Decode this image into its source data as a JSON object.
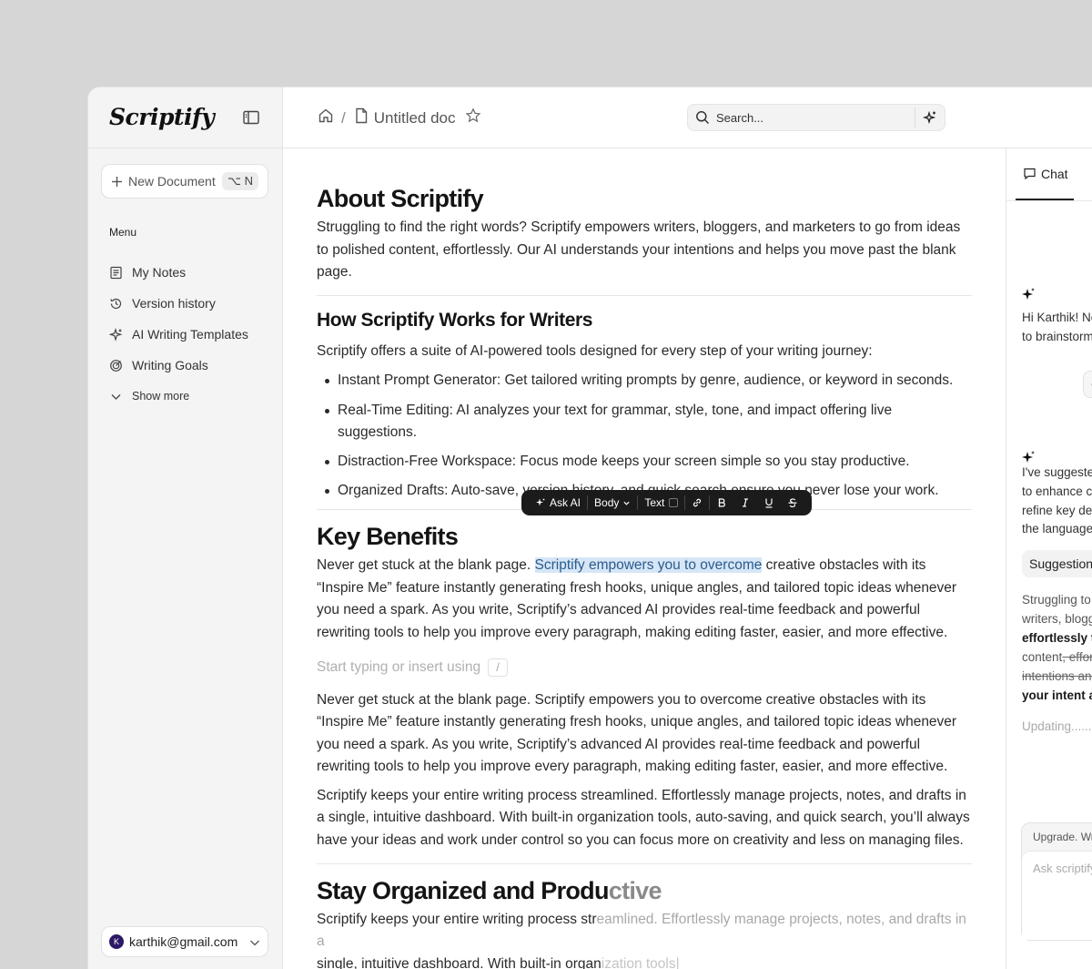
{
  "app": {
    "name": "Scriptify"
  },
  "sidebar": {
    "new_document_label": "New Document",
    "new_document_shortcut": "⌥ N",
    "menu_title": "Menu",
    "items": [
      {
        "label": "My Notes",
        "icon": "notes-icon"
      },
      {
        "label": "Version history",
        "icon": "history-icon"
      },
      {
        "label": "AI Writing Templates",
        "icon": "sparkle-icon"
      },
      {
        "label": "Writing Goals",
        "icon": "target-icon"
      },
      {
        "label": "Show more",
        "icon": "chevron-down-icon"
      }
    ],
    "account": {
      "avatar_letter": "K",
      "email": "karthik@gmail.com"
    }
  },
  "topbar": {
    "breadcrumb_separator": "/",
    "doc_title": "Untitled doc",
    "search_placeholder": "Search..."
  },
  "editor": {
    "about_title": "About Scriptify",
    "about_body": "Struggling to find the right words? Scriptify empowers writers, bloggers, and marketers to go from ideas to polished content, effortlessly. Our AI understands your intentions and helps you move past the blank page.",
    "how_title": "How Scriptify Works for Writers",
    "how_intro": "Scriptify offers a suite of AI-powered tools designed for every step of your writing journey:",
    "bullets": [
      "Instant Prompt Generator: Get tailored writing prompts by genre, audience, or keyword in seconds.",
      "Real-Time Editing: AI analyzes your text for grammar, style, tone, and impact offering live suggestions.",
      "Distraction-Free Workspace: Focus mode keeps your screen simple so you stay productive.",
      "Organized Drafts: Auto-save, version history, and quick search ensure you never lose your work."
    ],
    "benefits_title": "Key Benefits",
    "benefits_p1_before": "Never get stuck at the blank page. ",
    "benefits_p1_highlight": "Scriptify empowers you to overcome",
    "benefits_p1_after": " creative obstacles with its “Inspire Me” feature instantly generating fresh hooks, unique angles, and tailored topic ideas whenever you need a spark. As you write, Scriptify’s advanced AI provides real-time feedback and powerful rewriting tools to help you improve every paragraph, making editing faster, easier, and more effective.",
    "insert_placeholder": "Start typing or insert using",
    "insert_key": "/",
    "benefits_p2": "Never get stuck at the blank page. Scriptify empowers you to overcome creative obstacles with its “Inspire Me” feature instantly generating fresh hooks, unique angles, and tailored topic ideas whenever you need a spark. As you write, Scriptify’s advanced AI provides real-time feedback and powerful rewriting tools to help you improve every paragraph, making editing faster, easier, and more effective.",
    "benefits_p3": "Scriptify keeps your entire writing process streamlined. Effortlessly manage projects, notes, and drafts in a single, intuitive dashboard. With built-in organization tools, auto-saving, and quick search, you’ll always have your ideas and work under control so you can focus more on creativity and less on managing files.",
    "organized_title_a": "Stay Organized and Produ",
    "organized_title_b": "ctive",
    "organized_body_a": "Scriptify keeps your entire writing process str",
    "organized_body_b": "eamlined. Effortlessly manage projects, notes, and drafts in a",
    "organized_body_c": "single, intuitive dashboard. With built-in organ",
    "organized_body_d": "ization tools|"
  },
  "format_toolbar": {
    "ask_ai": "Ask AI",
    "block_type": "Body",
    "text_label": "Text",
    "buttons": [
      "link-icon",
      "bold-icon",
      "italic-icon",
      "underline-icon",
      "strikethrough-icon"
    ]
  },
  "chat": {
    "tab_label": "Chat",
    "msg1_lines": [
      "Hi Karthik! Ne",
      "to brainstorm,"
    ],
    "chip_text": "C",
    "msg2_lines": [
      "I've suggestec",
      "to enhance cla",
      "refine key des",
      "the language"
    ],
    "suggestions_label": "Suggestions",
    "diff_lines": {
      "l1": "Struggling to f",
      "l2": "writers, blogg",
      "l3": "effortlessly t",
      "l4a": "content",
      "l4b": ", effor",
      "l5": "intentions and",
      "l6": "your intent ar"
    },
    "updating": "Updating........",
    "composer_banner": "Upgrade. Writ",
    "composer_placeholder": "Ask scriptify"
  }
}
